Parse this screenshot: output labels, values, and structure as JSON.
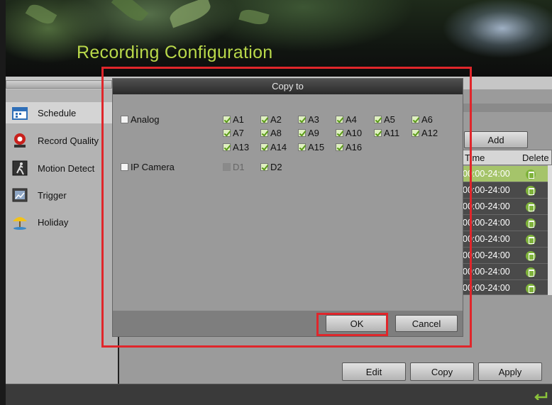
{
  "page_title": "Recording Configuration",
  "sidebar": {
    "items": [
      {
        "label": "Schedule",
        "icon": "calendar-icon",
        "active": true
      },
      {
        "label": "Record Quality",
        "icon": "record-icon",
        "active": false
      },
      {
        "label": "Motion Detect",
        "icon": "motion-icon",
        "active": false
      },
      {
        "label": "Trigger",
        "icon": "trigger-icon",
        "active": false
      },
      {
        "label": "Holiday",
        "icon": "holiday-icon",
        "active": false
      }
    ]
  },
  "schedule": {
    "add_label": "Add",
    "columns": [
      "Time",
      "Delete"
    ],
    "rows": [
      {
        "time": "00:00-24:00"
      },
      {
        "time": "00:00-24:00"
      },
      {
        "time": "00:00-24:00"
      },
      {
        "time": "00:00-24:00"
      },
      {
        "time": "00:00-24:00"
      },
      {
        "time": "00:00-24:00"
      },
      {
        "time": "00:00-24:00"
      },
      {
        "time": "00:00-24:00"
      }
    ]
  },
  "bottom_buttons": {
    "edit": "Edit",
    "copy": "Copy",
    "apply": "Apply"
  },
  "dialog": {
    "title": "Copy to",
    "analog_label": "Analog",
    "analog_channels": [
      [
        "A1",
        "A2",
        "A3",
        "A4",
        "A5",
        "A6"
      ],
      [
        "A7",
        "A8",
        "A9",
        "A10",
        "A11",
        "A12"
      ],
      [
        "A13",
        "A14",
        "A15",
        "A16"
      ]
    ],
    "ip_label": "IP Camera",
    "ip_channels": [
      "D1",
      "D2"
    ],
    "ok_label": "OK",
    "cancel_label": "Cancel"
  },
  "colors": {
    "title": "#b9d84a",
    "highlight": "#e0262b",
    "selected_row": "#a5c46a"
  }
}
